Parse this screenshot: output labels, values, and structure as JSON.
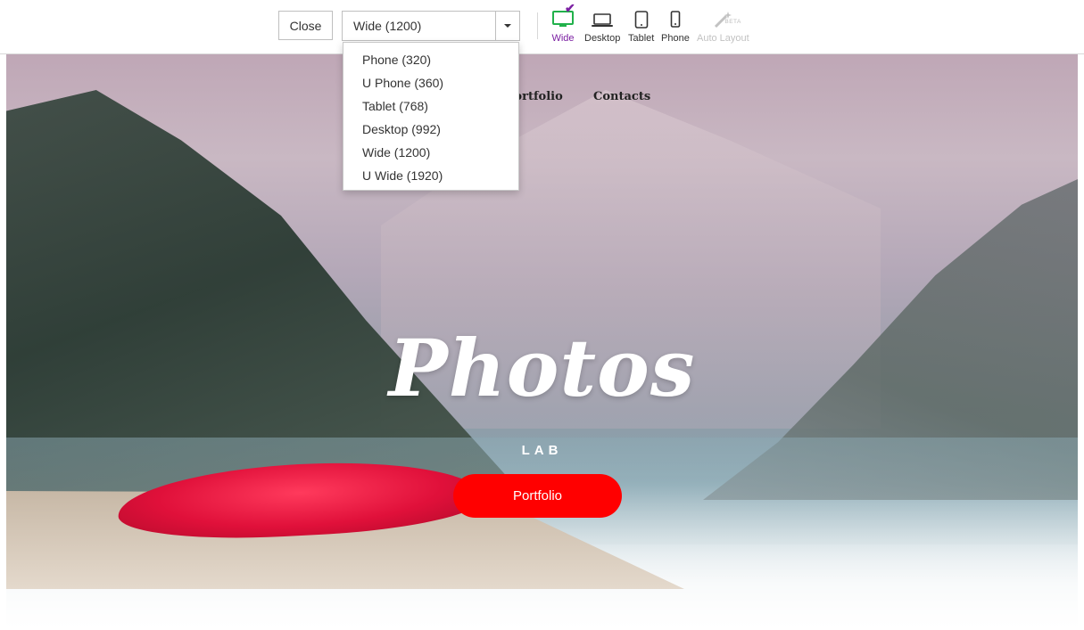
{
  "toolbar": {
    "close_label": "Close",
    "resolution_select": {
      "value": "Wide (1200)"
    },
    "devices": [
      {
        "label": "Wide",
        "icon": "monitor-icon",
        "state": "active"
      },
      {
        "label": "Desktop",
        "icon": "laptop-icon",
        "state": "normal"
      },
      {
        "label": "Tablet",
        "icon": "tablet-icon",
        "state": "normal"
      },
      {
        "label": "Phone",
        "icon": "phone-icon",
        "state": "normal"
      },
      {
        "label": "Auto Layout",
        "icon": "magic-wand-icon",
        "state": "disabled",
        "badge": "BETA"
      }
    ]
  },
  "dropdown": {
    "options": [
      "Phone (320)",
      "U Phone (360)",
      "Tablet (768)",
      "Desktop (992)",
      "Wide (1200)",
      "U Wide (1920)"
    ]
  },
  "preview": {
    "nav": [
      "Portfolio",
      "Contacts"
    ],
    "hero": {
      "title": "Photos",
      "subtitle": "LAB",
      "button_label": "Portfolio"
    }
  },
  "colors": {
    "active_device": "#7b1fa2",
    "monitor_icon": "#21b14b",
    "cta_button": "#ff0000"
  }
}
